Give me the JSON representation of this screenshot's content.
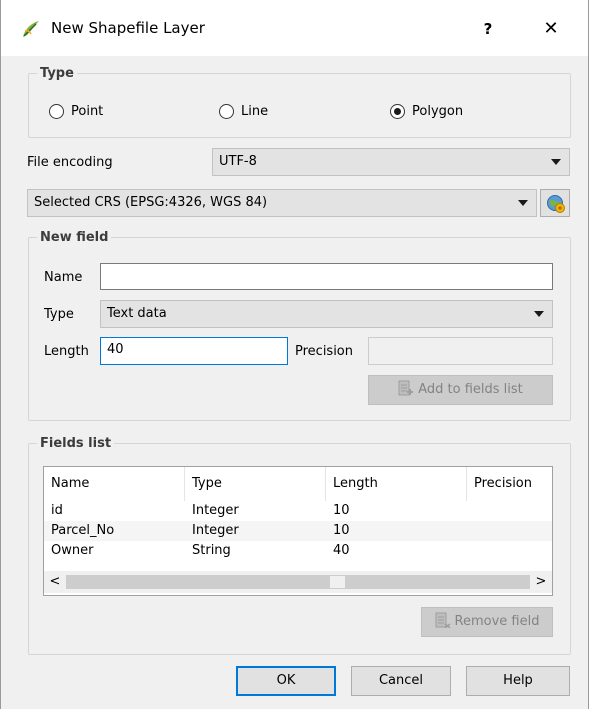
{
  "window": {
    "title": "New Shapefile Layer",
    "help_label": "?",
    "close_label": "✕"
  },
  "type_group": {
    "title": "Type",
    "options": [
      {
        "label": "Point",
        "selected": false
      },
      {
        "label": "Line",
        "selected": false
      },
      {
        "label": "Polygon",
        "selected": true
      }
    ]
  },
  "encoding": {
    "label": "File encoding",
    "value": "UTF-8"
  },
  "crs": {
    "value": "Selected CRS (EPSG:4326, WGS 84)",
    "button_icon": "globe-icon"
  },
  "new_field": {
    "title": "New field",
    "name_label": "Name",
    "name_value": "",
    "type_label": "Type",
    "type_value": "Text data",
    "length_label": "Length",
    "length_value": "40",
    "precision_label": "Precision",
    "precision_value": "",
    "add_button": "Add to fields list"
  },
  "fields_list": {
    "title": "Fields list",
    "columns": [
      "Name",
      "Type",
      "Length",
      "Precision"
    ],
    "rows": [
      [
        "id",
        "Integer",
        "10",
        ""
      ],
      [
        "Parcel_No",
        "Integer",
        "10",
        ""
      ],
      [
        "Owner",
        "String",
        "40",
        ""
      ]
    ],
    "scroll_left": "<",
    "scroll_right": ">",
    "remove_button": "Remove field"
  },
  "footer": {
    "ok": "OK",
    "cancel": "Cancel",
    "help": "Help"
  },
  "colors": {
    "focus_border": "#0078d7",
    "dialog_bg": "#f0f0f0"
  }
}
